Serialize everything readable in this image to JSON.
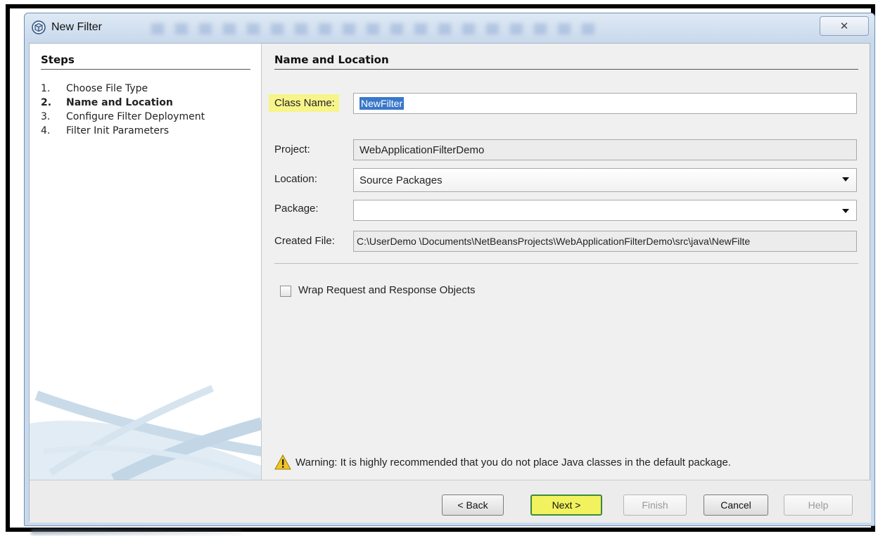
{
  "window": {
    "title": "New Filter",
    "close_glyph": "✕"
  },
  "steps": {
    "title": "Steps",
    "items": [
      {
        "num": "1.",
        "label": "Choose File Type"
      },
      {
        "num": "2.",
        "label": "Name and Location"
      },
      {
        "num": "3.",
        "label": "Configure Filter Deployment"
      },
      {
        "num": "4.",
        "label": "Filter Init Parameters"
      }
    ]
  },
  "form": {
    "section_title": "Name and Location",
    "class_name": {
      "label": "Class Name:",
      "value": "NewFilter"
    },
    "project": {
      "label": "Project:",
      "value": "WebApplicationFilterDemo"
    },
    "location": {
      "label": "Location:",
      "value": "Source Packages"
    },
    "package": {
      "label": "Package:",
      "value": ""
    },
    "created_file": {
      "label": "Created File:",
      "value": "C:\\UserDemo \\Documents\\NetBeansProjects\\WebApplicationFilterDemo\\src\\java\\NewFilte"
    },
    "wrap_checkbox": {
      "label": "Wrap Request and Response Objects",
      "checked": false
    },
    "warning": "Warning: It is highly recommended that you do not place Java classes in the default package."
  },
  "buttons": {
    "back": "< Back",
    "next": "Next >",
    "finish": "Finish",
    "cancel": "Cancel",
    "help": "Help"
  },
  "colors": {
    "highlight": "#f7f48a",
    "selection": "#3a78c9",
    "next_border": "#3c8a3c"
  }
}
